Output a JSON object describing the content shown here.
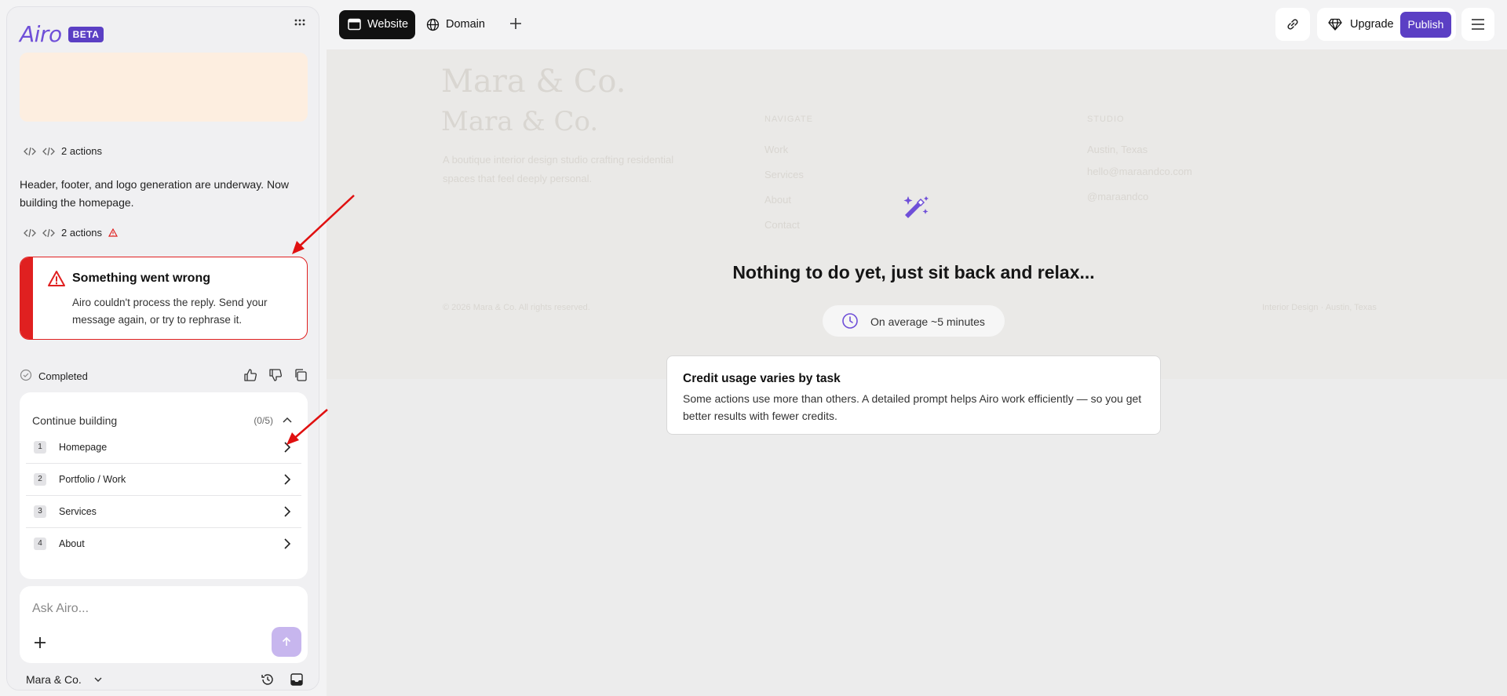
{
  "sidebar": {
    "brand": "Airo",
    "badge": "BETA",
    "actions_1": "2 actions",
    "message": "Header, footer, and logo generation are underway. Now building the homepage.",
    "actions_2": "2 actions",
    "error": {
      "title": "Something went wrong",
      "body": "Airo couldn't process the reply. Send your message again, or try to rephrase it."
    },
    "status": "Completed",
    "continue": {
      "title": "Continue building",
      "count": "(0/5)",
      "items": [
        {
          "num": "1",
          "label": "Homepage"
        },
        {
          "num": "2",
          "label": "Portfolio / Work"
        },
        {
          "num": "3",
          "label": "Services"
        },
        {
          "num": "4",
          "label": "About"
        }
      ]
    },
    "input": {
      "placeholder": "Ask Airo..."
    },
    "project": "Mara & Co."
  },
  "topbar": {
    "tabs": [
      {
        "label": "Website",
        "active": true
      },
      {
        "label": "Domain",
        "active": false
      }
    ],
    "upgrade": "Upgrade",
    "publish": "Publish"
  },
  "canvas": {
    "ghost": {
      "logo1": "Mara & Co.",
      "logo2": "Mara & Co.",
      "tagline1": "A boutique interior design studio crafting residential",
      "tagline2": "spaces that feel deeply personal.",
      "nav_heading": "NAVIGATE",
      "nav": [
        "Work",
        "Services",
        "About",
        "Contact"
      ],
      "studio_heading": "STUDIO",
      "studio": [
        "Austin, Texas",
        "hello@maraandco.com",
        "@maraandco"
      ],
      "copyright": "© 2026 Mara & Co. All rights reserved.",
      "footer_right": "Interior Design · Austin, Texas"
    },
    "headline": "Nothing to do yet, just sit back and relax...",
    "average": "On average ~5 minutes",
    "credit": {
      "title": "Credit usage varies by task",
      "body": "Some actions use more than others. A detailed prompt helps Airo work efficiently — so you get better results with fewer credits."
    }
  },
  "colors": {
    "brand": "#5b3fc4",
    "error": "#e02020",
    "annotation_arrow": "#e01010"
  }
}
